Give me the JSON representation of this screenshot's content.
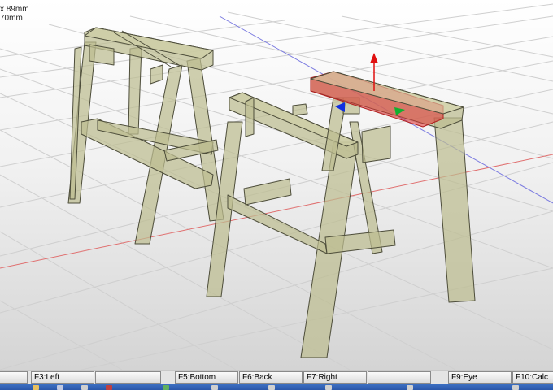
{
  "viewport": {
    "dimension_line1": "x 89mm",
    "dimension_line2": "70mm",
    "selection_color": "#e03030",
    "axis_colors": {
      "x": "#10b030",
      "y": "#1030e0",
      "z": "#e01010"
    },
    "wood_color": "#c8c89a",
    "grid_lines": {
      "x_axis": "#e07070",
      "y_axis": "#7070e0"
    }
  },
  "function_keys": [
    {
      "label": "",
      "name": "fkey-f1"
    },
    {
      "label": "F3:Left",
      "name": "fkey-f3-left"
    },
    {
      "label": "",
      "name": "fkey-f4"
    },
    {
      "label": "F5:Bottom",
      "name": "fkey-f5-bottom"
    },
    {
      "label": "F6:Back",
      "name": "fkey-f6-back"
    },
    {
      "label": "F7:Right",
      "name": "fkey-f7-right"
    },
    {
      "label": "",
      "name": "fkey-f8"
    },
    {
      "label": "F9:Eye",
      "name": "fkey-f9-eye"
    },
    {
      "label": "F10:Calc",
      "name": "fkey-f10-calc"
    }
  ],
  "taskbar": {
    "icons": [
      "folder-icon",
      "app-icon",
      "app-icon",
      "app-icon",
      "app-icon",
      "app-icon",
      "app-icon",
      "app-icon",
      "app-icon",
      "app-icon"
    ]
  }
}
